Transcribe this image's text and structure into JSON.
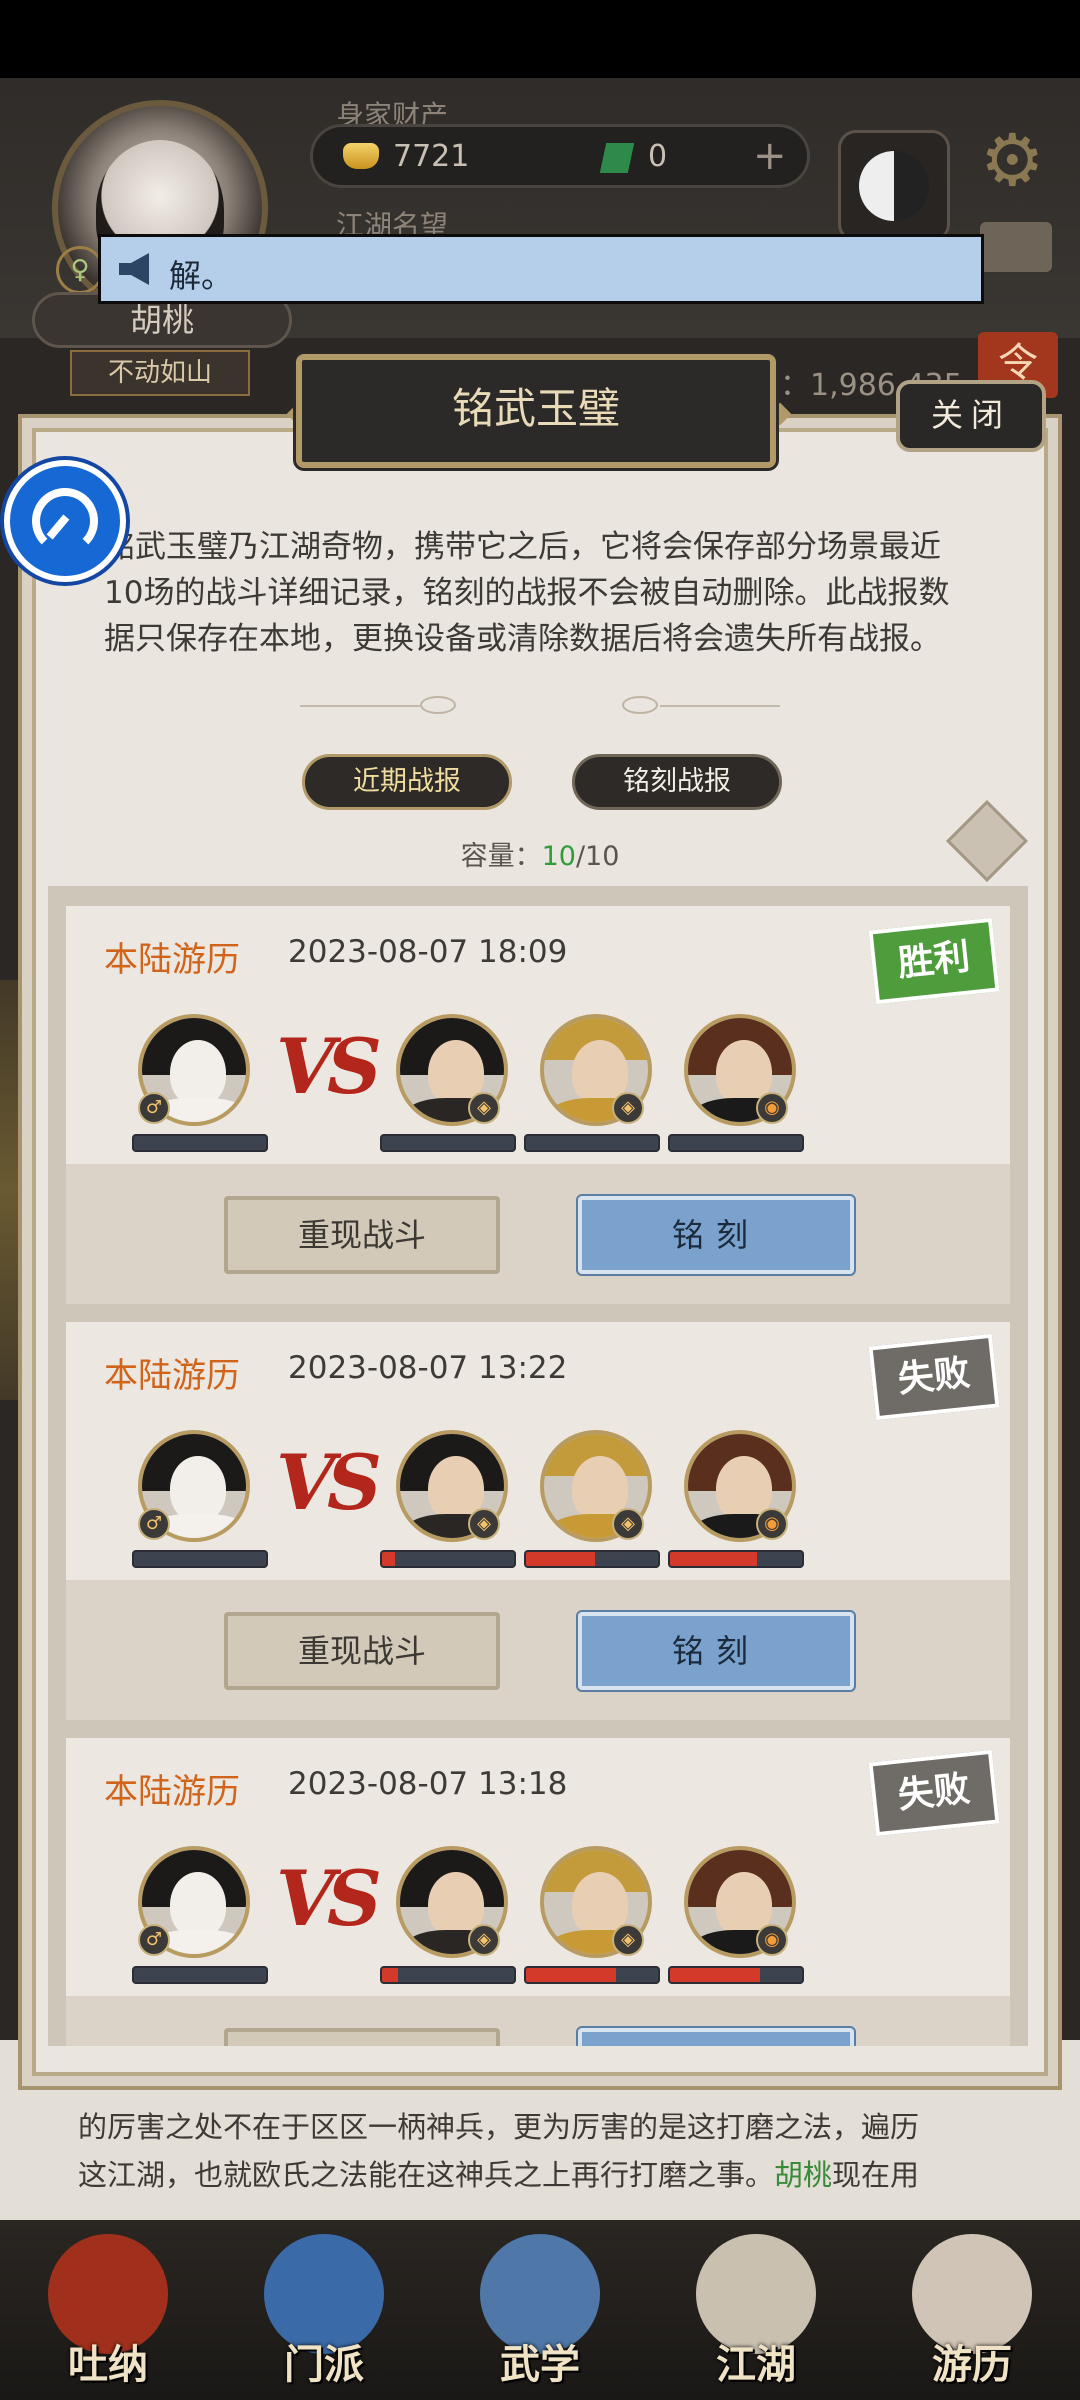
{
  "hud": {
    "wealth_label": "身家财产",
    "gold": "7721",
    "jade": "0",
    "plus": "+",
    "fame_label": "江湖名望",
    "gender_symbol": "♀",
    "player_name": "胡桃",
    "player_title": "不动如山",
    "stat_text": "属性：1,986,435",
    "red_btn_glyph": "令"
  },
  "banner": {
    "text": "解。"
  },
  "modal": {
    "title": "铭武玉璧",
    "close_label": "关闭",
    "description": "铭武玉璧乃江湖奇物，携带它之后，它将会保存部分场景最近10场的战斗详细记录，铭刻的战报不会被自动删除。此战报数据只保存在本地，更换设备或清除数据后将会遗失所有战报。",
    "tabs": {
      "recent": "近期战报",
      "engraved": "铭刻战报"
    },
    "capacity_label": "容量：",
    "capacity_used": "10",
    "capacity_total": "/10",
    "vs_text": "VS",
    "replay_label": "重现战斗",
    "engrave_label": "铭刻"
  },
  "reports": [
    {
      "type": "本陆游历",
      "time": "2023-08-07 18:09",
      "result": "胜利",
      "result_kind": "win",
      "player_hp": 0,
      "enemy_hp": [
        0,
        0,
        0
      ]
    },
    {
      "type": "本陆游历",
      "time": "2023-08-07 13:22",
      "result": "失败",
      "result_kind": "lose",
      "player_hp": 0,
      "enemy_hp": [
        0.1,
        0.52,
        0.66
      ]
    },
    {
      "type": "本陆游历",
      "time": "2023-08-07 13:18",
      "result": "失败",
      "result_kind": "lose",
      "player_hp": 0,
      "enemy_hp": [
        0.12,
        0.68,
        0.68
      ]
    }
  ],
  "background_story": {
    "line1": "的厉害之处不在于区区一柄神兵，更为厉害的是这打磨之法，遍历",
    "line2a": "这江湖，也就欧氏之法能在这神兵之上再行打磨之事。",
    "line2_name": "胡桃",
    "line2b": "现在用"
  },
  "nav": [
    {
      "label": "吐纳",
      "color": "#a0301c"
    },
    {
      "label": "门派",
      "color": "#3b6aa8"
    },
    {
      "label": "武学",
      "color": "#4f78a8"
    },
    {
      "label": "江湖",
      "color": "#c9c0b0"
    },
    {
      "label": "游历",
      "color": "#cfc4b5"
    }
  ],
  "colors": {
    "accent_gold": "#b19968",
    "engrave_blue": "#7aa2cc",
    "win_green": "#4f9c3d",
    "hp_red": "#d33a2a"
  }
}
